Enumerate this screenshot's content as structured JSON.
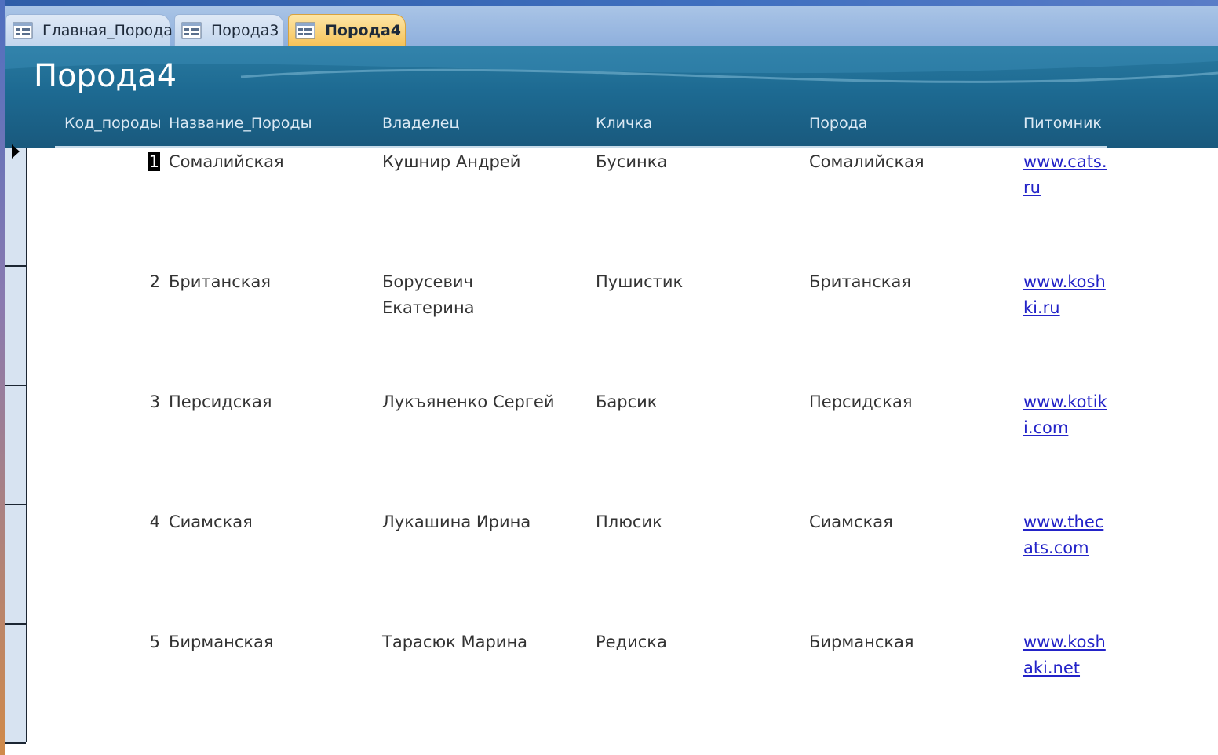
{
  "tabs": [
    {
      "label": "Главная_Порода",
      "active": false
    },
    {
      "label": "Порода3",
      "active": false
    },
    {
      "label": "Порода4",
      "active": true
    }
  ],
  "form": {
    "title": "Порода4",
    "columns": [
      "Код_породы",
      "Название_Породы",
      "Владелец",
      "Кличка",
      "Порода",
      "Питомник"
    ]
  },
  "records": [
    {
      "id": "1",
      "name": "Сомалийская",
      "owner": "Кушнир Андрей",
      "nickname": "Бусинка",
      "breed": "Сомалийская",
      "kennel": "www.cats.ru"
    },
    {
      "id": "2",
      "name": "Британская",
      "owner": "Борусевич Екатерина",
      "nickname": "Пушистик",
      "breed": "Британская",
      "kennel": "www.koshki.ru"
    },
    {
      "id": "3",
      "name": "Персидская",
      "owner": "Лукъяненко Сергей",
      "nickname": "Барсик",
      "breed": "Персидская",
      "kennel": "www.kotiki.com"
    },
    {
      "id": "4",
      "name": "Сиамская",
      "owner": "Лукашина Ирина",
      "nickname": "Плюсик",
      "breed": "Сиамская",
      "kennel": "www.thecats.com"
    },
    {
      "id": "5",
      "name": "Бирманская",
      "owner": "Тарасюк Марина",
      "nickname": "Редиска",
      "breed": "Бирманская",
      "kennel": "www.koshaki.net"
    }
  ],
  "icons": {
    "tab": "form-icon",
    "current_record": "current-record-arrow-icon"
  },
  "colors": {
    "header": "#1d6a92",
    "active_tab": "#f6c35a",
    "link": "#2323c8"
  }
}
